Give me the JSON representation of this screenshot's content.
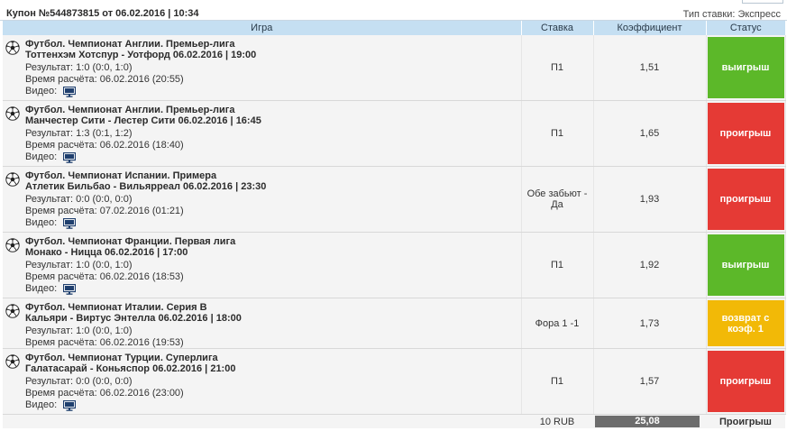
{
  "coupon": {
    "title": "Купон №544873815 от 06.02.2016 | 10:34",
    "bet_type": "Тип ставки: Экспресс"
  },
  "headers": {
    "game": "Игра",
    "stake": "Ставка",
    "coef": "Коэффициент",
    "status": "Статус"
  },
  "rows": [
    {
      "league": "Футбол. Чемпионат Англии. Премьер-лига",
      "match": "Тоттенхэм Хотспур - Уотфорд 06.02.2016 | 19:00",
      "result": "Результат: 1:0 (0:0, 1:0)",
      "calc": "Время расчёта: 06.02.2016 (20:55)",
      "video": "Видео:",
      "stake": "П1",
      "coef": "1,51",
      "status": "выигрыш",
      "status_type": "win"
    },
    {
      "league": "Футбол. Чемпионат Англии. Премьер-лига",
      "match": "Манчестер Сити - Лестер Сити 06.02.2016 | 16:45",
      "result": "Результат: 1:3 (0:1, 1:2)",
      "calc": "Время расчёта: 06.02.2016 (18:40)",
      "video": "Видео:",
      "stake": "П1",
      "coef": "1,65",
      "status": "проигрыш",
      "status_type": "lose"
    },
    {
      "league": "Футбол. Чемпионат Испании. Примера",
      "match": "Атлетик Бильбао - Вильярреал 06.02.2016 | 23:30",
      "result": "Результат: 0:0 (0:0, 0:0)",
      "calc": "Время расчёта: 07.02.2016 (01:21)",
      "video": "Видео:",
      "stake": "Обе забьют - Да",
      "coef": "1,93",
      "status": "проигрыш",
      "status_type": "lose"
    },
    {
      "league": "Футбол. Чемпионат Франции. Первая лига",
      "match": "Монако - Ницца 06.02.2016 | 17:00",
      "result": "Результат: 1:0 (0:0, 1:0)",
      "calc": "Время расчёта: 06.02.2016 (18:53)",
      "video": "Видео:",
      "stake": "П1",
      "coef": "1,92",
      "status": "выигрыш",
      "status_type": "win"
    },
    {
      "league": "Футбол. Чемпионат Италии. Серия B",
      "match": "Кальяри - Виртус Энтелла 06.02.2016 | 18:00",
      "result": "Результат: 1:0 (0:0, 1:0)",
      "calc": "Время расчёта: 06.02.2016 (19:53)",
      "video": "",
      "stake": "Фора 1 -1",
      "coef": "1,73",
      "status": "возврат с коэф. 1",
      "status_type": "ret"
    },
    {
      "league": "Футбол. Чемпионат Турции. Суперлига",
      "match": "Галатасарай - Коньяспор 06.02.2016 | 21:00",
      "result": "Результат: 0:0 (0:0, 0:0)",
      "calc": "Время расчёта: 06.02.2016 (23:00)",
      "video": "Видео:",
      "stake": "П1",
      "coef": "1,57",
      "status": "проигрыш",
      "status_type": "lose"
    }
  ],
  "footer": {
    "amount": "10 RUB",
    "total_coef": "25,08",
    "result": "Проигрыш"
  },
  "icons": {
    "sport": "soccer-ball-icon",
    "video": "monitor-icon"
  },
  "colors": {
    "win": "#5cb829",
    "lose": "#e53a35",
    "return": "#f2b907",
    "header_bg": "#c5dff2"
  }
}
